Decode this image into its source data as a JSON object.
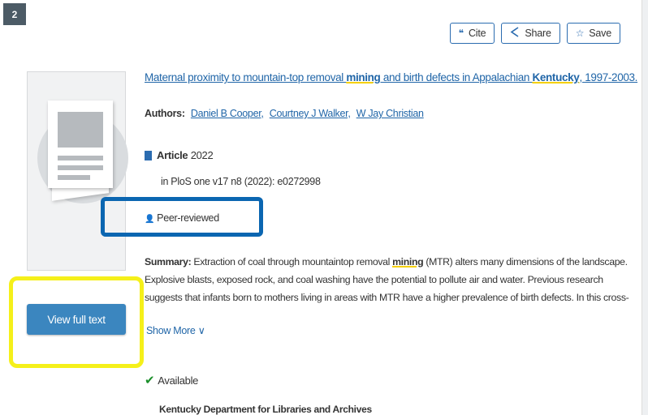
{
  "result": {
    "number": "2",
    "actions": {
      "cite": "Cite",
      "share": "Share",
      "save": "Save"
    },
    "title_parts": {
      "part1": "Maternal proximity to mountain-top removal ",
      "hl1": "mining",
      "part2": " and birth defects in Appalachian ",
      "hl2": "Kentucky",
      "part3": ", 1997-2003."
    },
    "authors_label": "Authors:",
    "authors": [
      "Daniel B Cooper,",
      "Courtney J Walker,",
      "W Jay Christian"
    ],
    "format_type": "Article",
    "format_year": "2022",
    "source": "in PloS one  v17 n8 (2022): e0272998",
    "peer_reviewed": "Peer-reviewed",
    "summary_label": "Summary:",
    "summary_parts": {
      "part1": " Extraction of coal through mountaintop removal ",
      "hl": "mining",
      "part2": " (MTR) alters many dimensions of the landscape. Explosive blasts, exposed rock, and coal washing have the potential to pollute air and water. Previous research suggests that infants born to mothers living in areas with MTR have a higher prevalence of birth defects. In this cross-sectional study, we further examine the"
    },
    "show_more": "Show More",
    "availability": "Available",
    "library": "Kentucky Department for Libraries and Archives",
    "view_full_text": "View full text"
  },
  "colors": {
    "link": "#2166a8",
    "button": "#3b86bf",
    "highlight_yellow": "#f5f01a",
    "highlight_blue": "#0b66b1",
    "available_green": "#1b8f2a"
  }
}
